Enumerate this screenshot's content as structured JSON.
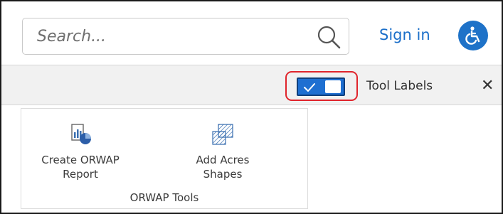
{
  "header": {
    "search_placeholder": "Search...",
    "sign_in_label": "Sign in",
    "search_icon": "search-icon",
    "accessibility_icon": "accessibility-icon"
  },
  "toolbar": {
    "toggle_state": "on",
    "tool_labels_text": "Tool Labels",
    "close_glyph": "✕"
  },
  "tools": {
    "group_label": "ORWAP Tools",
    "items": [
      {
        "label_line1": "Create ORWAP",
        "label_line2": "Report",
        "icon": "report-chart-icon"
      },
      {
        "label_line1": "Add Acres",
        "label_line2": "Shapes",
        "icon": "add-shapes-icon"
      }
    ]
  },
  "colors": {
    "accent": "#1e72c8",
    "link": "#1b6fc9",
    "highlight": "#e0242b"
  }
}
